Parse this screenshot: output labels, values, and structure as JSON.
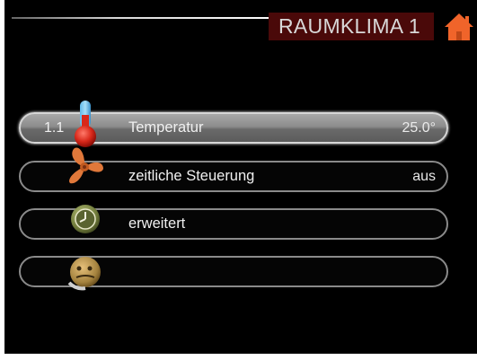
{
  "header": {
    "title": "RAUMKLIMA 1",
    "home_icon": "home-icon",
    "title_bg": "#4a0909",
    "home_color": "#f0642a"
  },
  "menu": {
    "items": [
      {
        "number": "1.1",
        "label": "Temperatur",
        "value": "25.0°",
        "icon": "thermometer-icon",
        "selected": true
      },
      {
        "number": "",
        "label": "zeitliche Steuerung",
        "value": "aus",
        "icon": "fan-icon",
        "selected": false
      },
      {
        "number": "",
        "label": "erweitert",
        "value": "",
        "icon": "clock-icon",
        "selected": false
      },
      {
        "number": "",
        "label": "",
        "value": "",
        "icon": "help-face-icon",
        "selected": false
      }
    ]
  }
}
